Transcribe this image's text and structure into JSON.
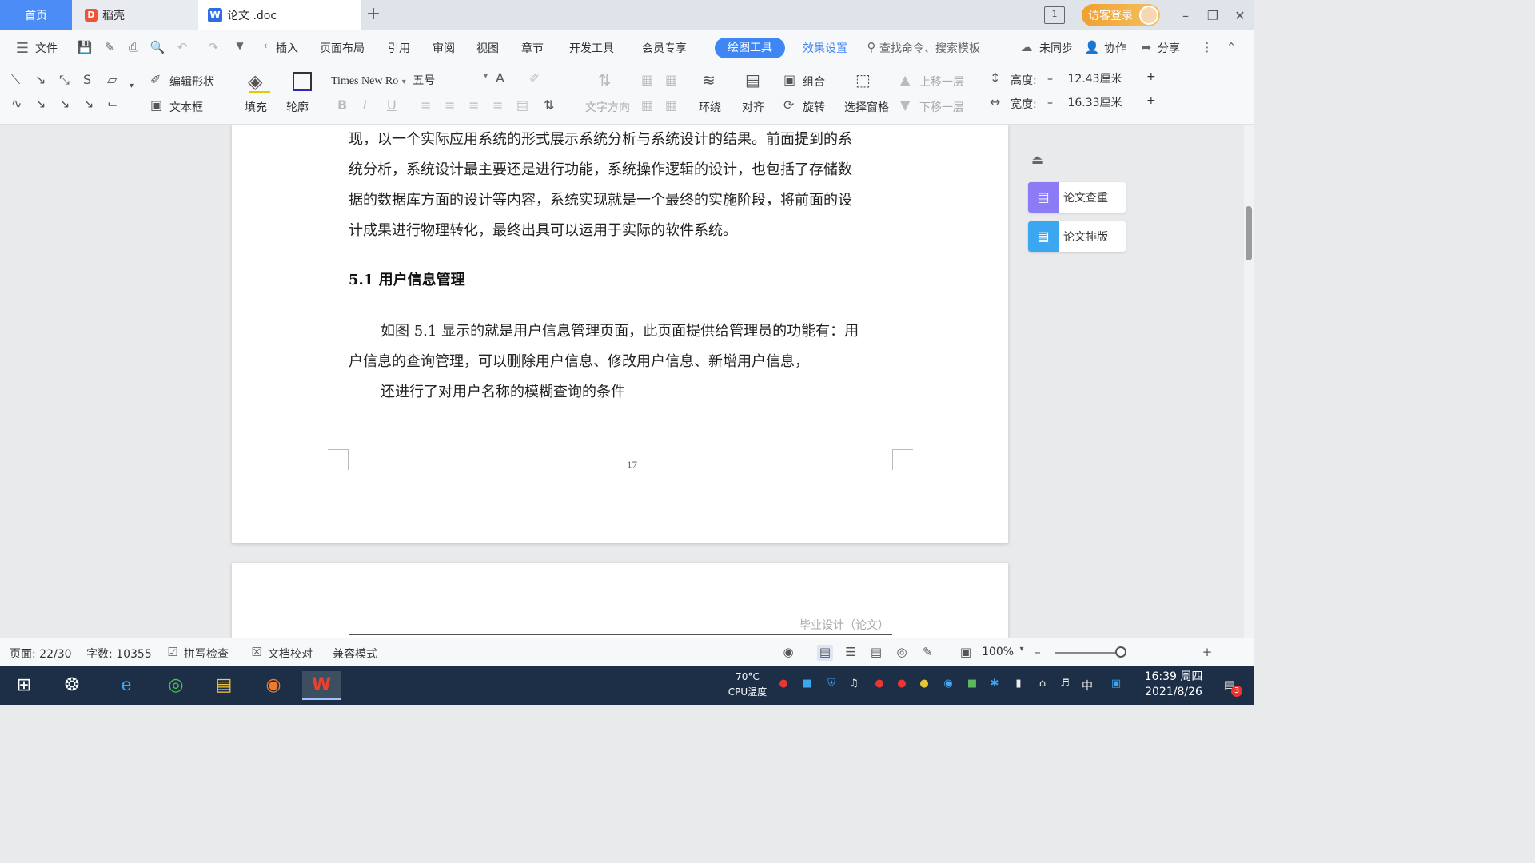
{
  "tabs": {
    "home": "首页",
    "daoke": "稻壳",
    "doc": "论文 .doc",
    "add": "+",
    "login": "访客登录"
  },
  "menu": {
    "file": "文件",
    "insert": "插入",
    "page_layout": "页面布局",
    "reference": "引用",
    "review": "审阅",
    "view": "视图",
    "chapter": "章节",
    "dev_tools": "开发工具",
    "member": "会员专享",
    "draw_tools": "绘图工具",
    "effects": "效果设置",
    "find_cmd": "查找命令、搜索模板",
    "unsync": "未同步",
    "collab": "协作",
    "share": "分享"
  },
  "toolbar": {
    "edit_shape": "编辑形状",
    "text_box": "文本框",
    "fill": "填充",
    "outline": "轮廓",
    "font_name": "Times New Ro",
    "font_size": "五号",
    "text_direction": "文字方向",
    "wrap": "环绕",
    "align": "对齐",
    "group": "组合",
    "rotate": "旋转",
    "select_pane": "选择窗格",
    "bring_forward": "上移一层",
    "send_backward": "下移一层",
    "height_label": "高度:",
    "height_value": "12.43厘米",
    "width_label": "宽度:",
    "width_value": "16.33厘米"
  },
  "document": {
    "para1_lines": [
      "现，以一个实际应用系统的形式展示系统分析与系统设计的结果。前面提到的系",
      "统分析，系统设计最主要还是进行功能，系统操作逻辑的设计，也包括了存储数",
      "据的数据库方面的设计等内容，系统实现就是一个最终的实施阶段，将前面的设",
      "计成果进行物理转化，最终出具可以运用于实际的软件系统。"
    ],
    "heading": "5.1 用户信息管理",
    "para2_lines": [
      "如图 5.1 显示的就是用户信息管理页面，此页面提供给管理员的功能有：用",
      "户信息的查询管理，可以删除用户信息、修改用户信息、新增用户信息，",
      "还进行了对用户名称的模糊查询的条件"
    ],
    "page_number": "17",
    "next_page_header": "毕业设计（论文）"
  },
  "side_panel": {
    "check": "论文查重",
    "format": "论文排版"
  },
  "status": {
    "page": "页面: 22/30",
    "words": "字数: 10355",
    "spell": "拼写检查",
    "proof": "文档校对",
    "compat": "兼容模式",
    "zoom": "100%"
  },
  "taskbar": {
    "cpu_temp": "70°C",
    "cpu_label": "CPU温度",
    "time": "16:39 周四",
    "date": "2021/8/26",
    "ime": "中",
    "notif_count": "3"
  }
}
